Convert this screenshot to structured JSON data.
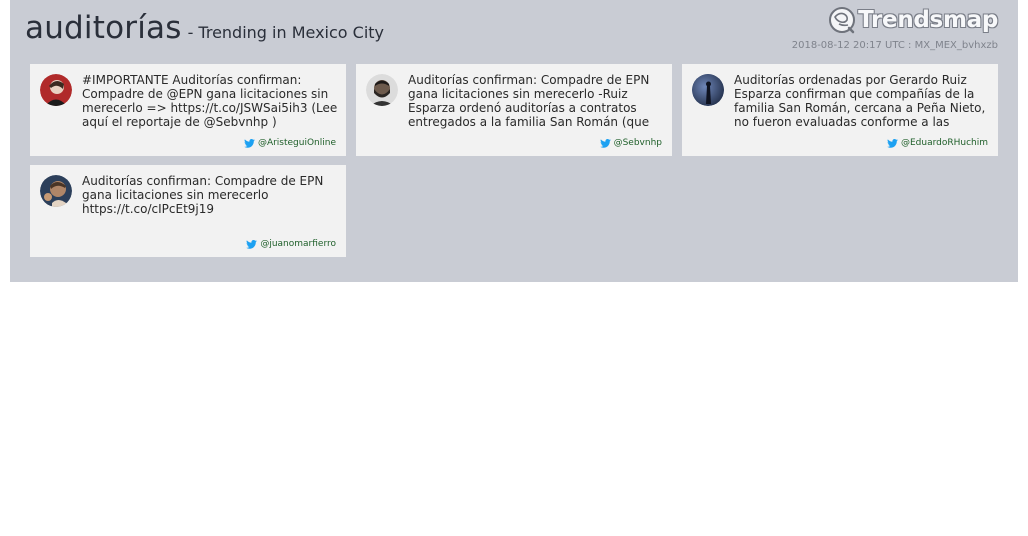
{
  "header": {
    "trend": "auditorías",
    "subtitle": "- Trending in Mexico City",
    "brand": "Trendsmap",
    "meta": "2018-08-12 20:17 UTC : MX_MEX_bvhxzb"
  },
  "icons": {
    "brand": "trendsmap-logo-icon",
    "bird": "twitter-bird-icon"
  },
  "colors": {
    "panel": "#c9ccd4",
    "card": "#f2f2f2",
    "bird": "#1da1f2",
    "handle": "#1f5f2a"
  },
  "cards": [
    {
      "text": " #IMPORTANTE   Auditorías confirman: Compadre de @EPN gana licitaciones sin merecerlo => https://t.co/JSWSai5ih3 (Lee aquí el reportaje de @Sebvnhp )",
      "handle": "@AristeguiOnline"
    },
    {
      "text": "Auditorías confirman: Compadre de EPN gana licitaciones sin merecerlo -Ruiz Esparza ordenó auditorías a contratos entregados a la familia San Román (que",
      "handle": "@Sebvnhp"
    },
    {
      "text": "Auditorías ordenadas por Gerardo Ruiz Esparza confirman que compañías de la familia San Román, cercana a Peña Nieto, no fueron evaluadas conforme a las",
      "handle": "@EduardoRHuchim"
    },
    {
      "text": "Auditorías confirman: Compadre de EPN gana licitaciones sin merecerlo https://t.co/cIPcEt9j19",
      "handle": "@juanomarfierro"
    }
  ]
}
